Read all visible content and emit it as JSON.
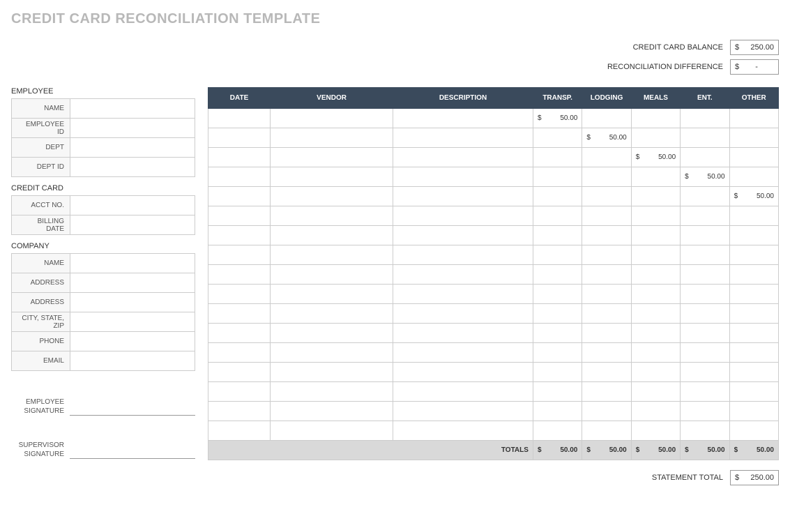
{
  "title": "CREDIT CARD RECONCILIATION TEMPLATE",
  "summary": {
    "credit_card_balance_label": "CREDIT CARD BALANCE",
    "credit_card_balance_value": "250.00",
    "reconciliation_diff_label": "RECONCILIATION DIFFERENCE",
    "reconciliation_diff_value": "-",
    "statement_total_label": "STATEMENT TOTAL",
    "statement_total_value": "250.00",
    "currency": "$"
  },
  "sections": {
    "employee": {
      "label": "EMPLOYEE",
      "fields": {
        "name": "NAME",
        "employee_id": "EMPLOYEE ID",
        "dept": "DEPT",
        "dept_id": "DEPT ID"
      }
    },
    "credit_card": {
      "label": "CREDIT CARD",
      "fields": {
        "acct_no": "ACCT NO.",
        "billing_date": "BILLING DATE"
      }
    },
    "company": {
      "label": "COMPANY",
      "fields": {
        "name": "NAME",
        "address1": "ADDRESS",
        "address2": "ADDRESS",
        "city_state_zip": "CITY, STATE, ZIP",
        "phone": "PHONE",
        "email": "EMAIL"
      }
    }
  },
  "signatures": {
    "employee": "EMPLOYEE SIGNATURE",
    "supervisor": "SUPERVISOR SIGNATURE"
  },
  "grid": {
    "headers": {
      "date": "DATE",
      "vendor": "VENDOR",
      "description": "DESCRIPTION",
      "transp": "TRANSP.",
      "lodging": "LODGING",
      "meals": "MEALS",
      "ent": "ENT.",
      "other": "OTHER"
    },
    "rows": [
      {
        "transp": "50.00"
      },
      {
        "lodging": "50.00"
      },
      {
        "meals": "50.00"
      },
      {
        "ent": "50.00"
      },
      {
        "other": "50.00"
      },
      {},
      {},
      {},
      {},
      {},
      {},
      {},
      {},
      {},
      {},
      {},
      {}
    ],
    "totals_label": "TOTALS",
    "totals": {
      "transp": "50.00",
      "lodging": "50.00",
      "meals": "50.00",
      "ent": "50.00",
      "other": "50.00"
    }
  }
}
